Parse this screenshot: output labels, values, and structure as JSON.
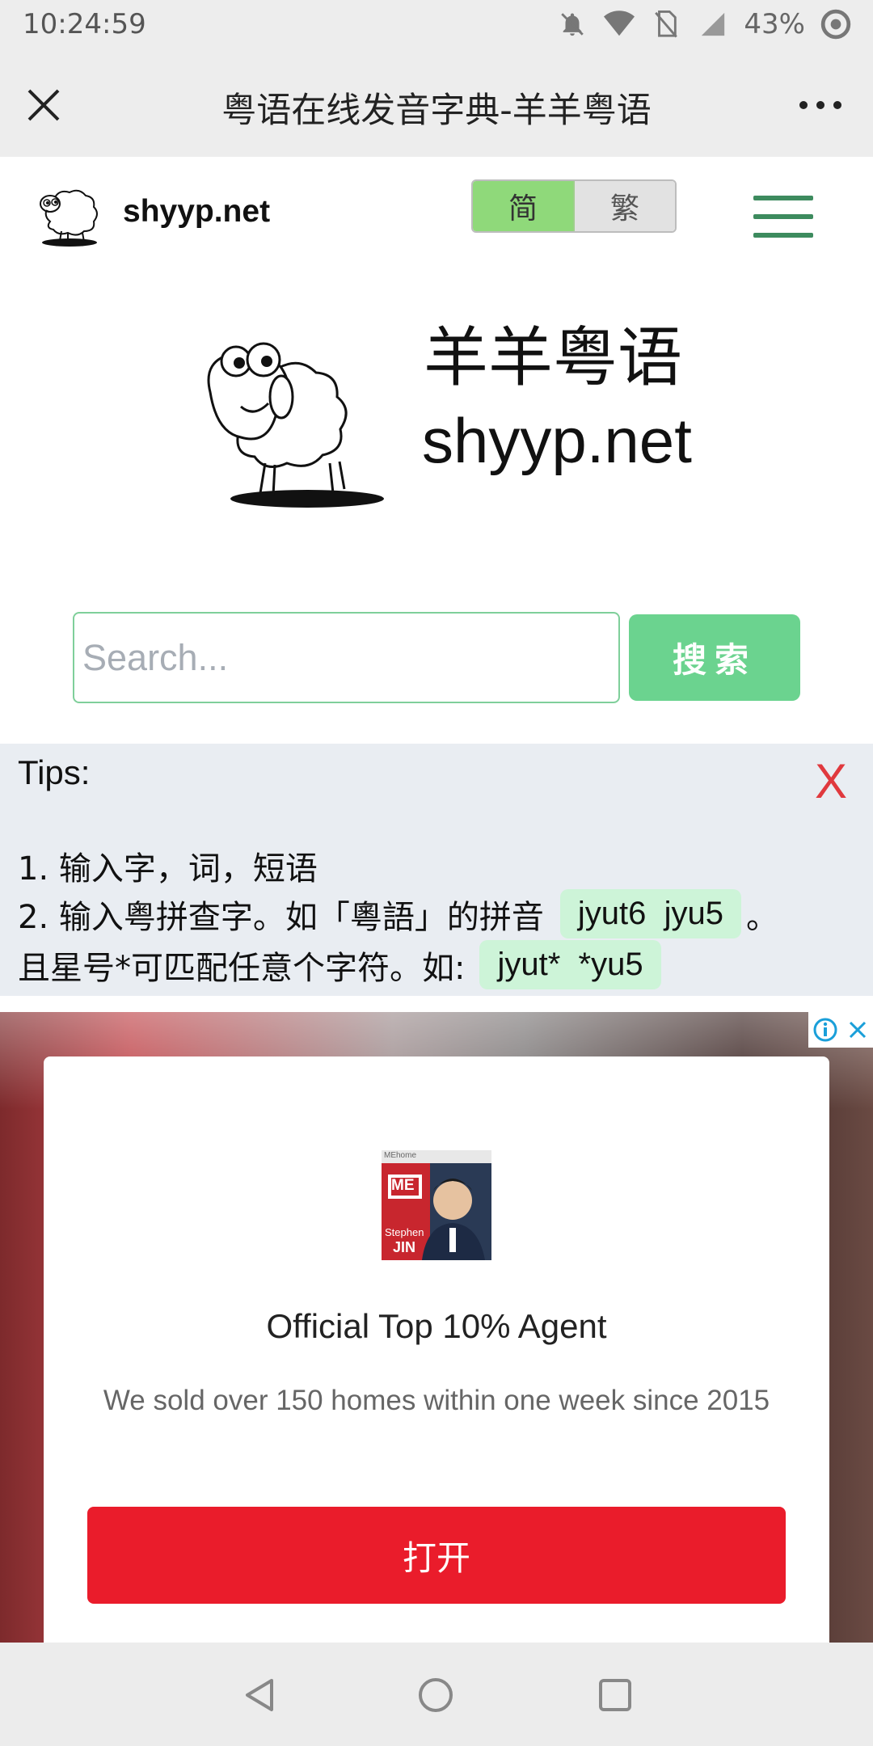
{
  "status_bar": {
    "time": "10:24:59",
    "battery": "43%"
  },
  "title_bar": {
    "title": "粤语在线发音字典-羊羊粤语"
  },
  "site_header": {
    "site_name": "shyyp.net",
    "lang_simplified": "简",
    "lang_traditional": "繁",
    "active_lang": "简"
  },
  "hero": {
    "title_cn": "羊羊粤语",
    "title_en": "shyyp.net"
  },
  "search": {
    "placeholder": "Search...",
    "button_label": "搜索"
  },
  "tips": {
    "title": "Tips:",
    "close_label": "X",
    "line1": "1. 输入字，词，短语",
    "line2_prefix": "2. 输入粤拼查字。如「粵語」的拼音",
    "line2_chip": "jyut6  jyu5",
    "line2_suffix": "。",
    "line3_prefix": "且星号*可匹配任意个字符。如:",
    "line3_chip": "jyut*  *yu5"
  },
  "ad": {
    "image_caption_top": "MEhome",
    "image_logo": "ME",
    "image_name_1": "Stephen",
    "image_name_2": "JIN",
    "headline": "Official Top 10% Agent",
    "description": "We sold over 150 homes within one week since 2015",
    "cta_label": "打开"
  },
  "colors": {
    "accent_green": "#6bd38f",
    "toggle_active": "#8fd97a",
    "hamburger": "#3d8b5e",
    "tips_bg": "#e9edf2",
    "chip_bg": "#cdf4d8",
    "close_red": "#e0393e",
    "ad_cta": "#ea1c2b"
  },
  "icons": {
    "status": [
      "bell-off-icon",
      "wifi-icon",
      "no-sim-icon",
      "signal-icon",
      "battery-icon"
    ],
    "nav": [
      "back-icon",
      "home-icon",
      "recents-icon"
    ]
  }
}
